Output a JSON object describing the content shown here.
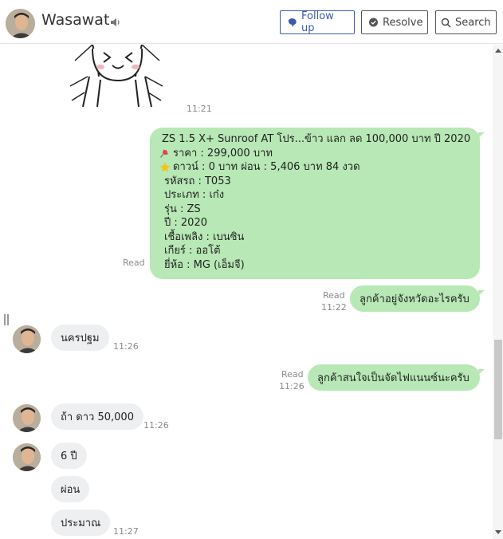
{
  "header": {
    "contact_name": "Wasawat",
    "follow_up_label": "Follow up",
    "resolve_label": "Resolve",
    "search_label": "Search"
  },
  "messages": {
    "sticker_time": "11:21",
    "car_listing": {
      "lines": [
        "ZS 1.5 X+ Sunroof AT โปร...ข้าว แลก ลด 100,000 บาท ปี 2020",
        "ราคา : 299,000 บาท",
        "ดาวน์ : 0 บาท ผ่อน : 5,406 บาท 84 งวด",
        "รหัสรถ : T053",
        "ประเภท : เก๋ง",
        "รุ่น : ZS",
        "ปี : 2020",
        "เชื้อเพลิง : เบนซิน",
        "เกียร์ : ออโต้",
        "ยี่ห้อ : MG (เอ็มจี)"
      ],
      "line_icons": [
        "car-icon",
        "pushpin-icon",
        "star-icon"
      ],
      "status": "Read"
    },
    "out1": {
      "text": "ลูกค้าอยู่จังหวัดอะไรครับ",
      "status": "Read",
      "time": "11:22"
    },
    "in1": {
      "text": "นครปฐม",
      "time": "11:26"
    },
    "out2": {
      "text": "ลูกค้าสนใจเป็นจัดไฟแนนซ์นะครับ",
      "status": "Read",
      "time": "11:26"
    },
    "in2": {
      "text": "ถ้า ดาว 50,000",
      "time": "11:26"
    },
    "in3": {
      "text": "6 ปี"
    },
    "in4": {
      "text": "ผ่อน"
    },
    "in5": {
      "text": "ประมาณ",
      "time": "11:27"
    }
  },
  "colors": {
    "outgoing_bubble": "#b7e8b5",
    "incoming_bubble": "#eeeff1",
    "follow_up_accent": "#3b5bb0"
  }
}
